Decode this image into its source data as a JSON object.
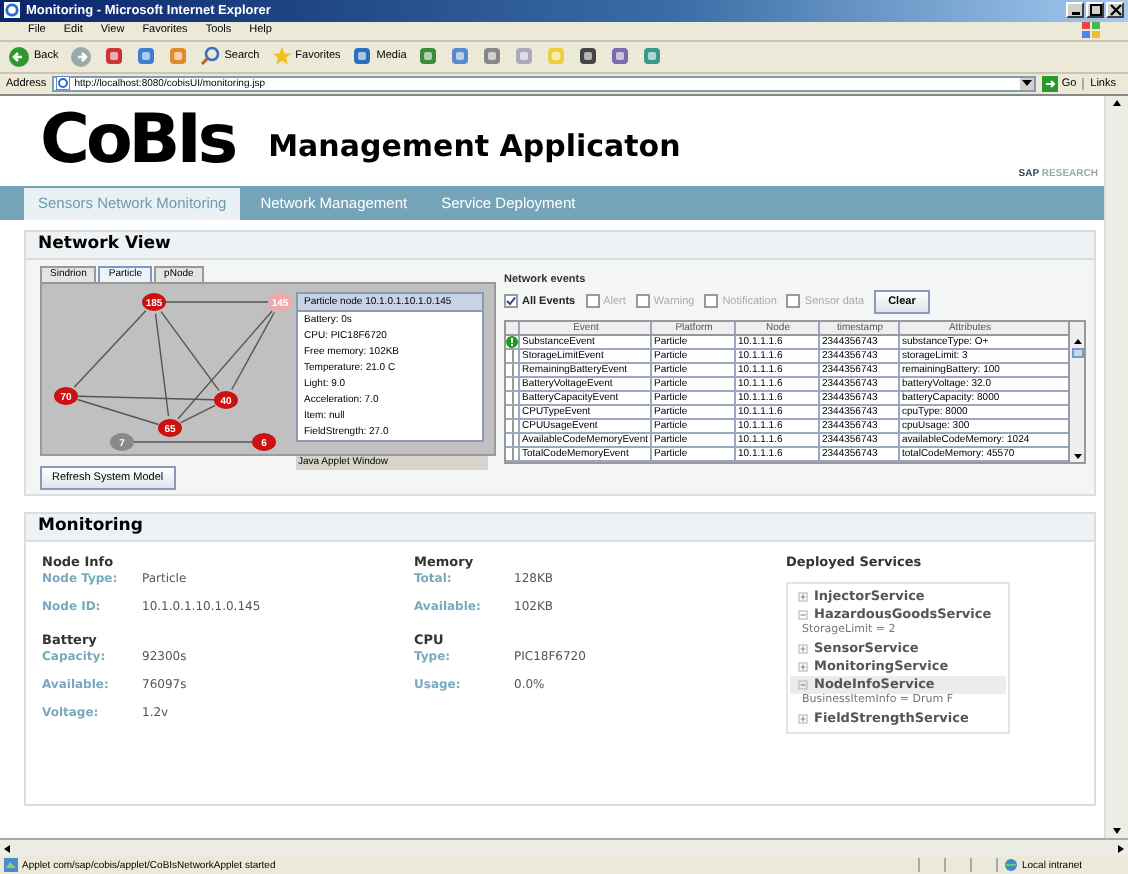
{
  "window": {
    "title": "Monitoring - Microsoft Internet Explorer"
  },
  "menu": [
    "File",
    "Edit",
    "View",
    "Favorites",
    "Tools",
    "Help"
  ],
  "toolbar": [
    {
      "kind": "back",
      "label": "Back"
    },
    {
      "kind": "forward"
    },
    {
      "kind": "stop"
    },
    {
      "kind": "refresh"
    },
    {
      "kind": "home"
    },
    {
      "kind": "search",
      "label": "Search"
    },
    {
      "kind": "favorites",
      "label": "Favorites"
    },
    {
      "kind": "media",
      "label": "Media"
    },
    {
      "kind": "history"
    },
    {
      "kind": "mail"
    },
    {
      "kind": "print"
    },
    {
      "kind": "edit"
    },
    {
      "kind": "note"
    },
    {
      "kind": "messenger"
    },
    {
      "kind": "tool"
    },
    {
      "kind": "network"
    }
  ],
  "address": {
    "label": "Address",
    "value": "http://localhost:8080/cobisUI/monitoring.jsp",
    "go": "Go",
    "links": "Links"
  },
  "header": {
    "logo": "CoBIs",
    "title": "Management Applicaton",
    "brand": "SAP",
    "brand_suffix": "RESEARCH"
  },
  "nav": [
    {
      "label": "Sensors Network Monitoring",
      "selected": true
    },
    {
      "label": "Network Management",
      "selected": false
    },
    {
      "label": "Service Deployment",
      "selected": false
    }
  ],
  "network_view": {
    "title": "Network View",
    "tabs": [
      {
        "label": "Sindrion",
        "selected": false
      },
      {
        "label": "Particle",
        "selected": true
      },
      {
        "label": "pNode",
        "selected": false
      }
    ],
    "nodes": [
      {
        "label": "185",
        "color": "#cc1111"
      },
      {
        "label": "145",
        "color": "#f2a8a8"
      },
      {
        "label": "70",
        "color": "#cc1111"
      },
      {
        "label": "40",
        "color": "#cc1111"
      },
      {
        "label": "65",
        "color": "#cc1111"
      },
      {
        "label": "7",
        "color": "#8a8a8a"
      },
      {
        "label": "6",
        "color": "#cc1111"
      }
    ],
    "tooltip": {
      "title": "Particle node 10.1.0.1.10.1.0.145",
      "lines": [
        "Battery: 0s",
        "CPU: PIC18F6720",
        "Free memory: 102KB",
        "Temperature: 21.0 C",
        "Light: 9.0",
        "Acceleration: 7.0",
        "Item: null",
        "FieldStrength: 27.0"
      ],
      "footer": "Java Applet Window"
    },
    "refresh_button": "Refresh System Model",
    "events": {
      "title": "Network events",
      "filters": [
        {
          "label": "All Events",
          "checked": true
        },
        {
          "label": "Alert",
          "checked": false
        },
        {
          "label": "Warning",
          "checked": false
        },
        {
          "label": "Notification",
          "checked": false
        },
        {
          "label": "Sensor data",
          "checked": false
        }
      ],
      "clear_button": "Clear",
      "columns": [
        "Event",
        "Platform",
        "Node",
        "timestamp",
        "Attributes"
      ],
      "rows": [
        {
          "kind": "alert",
          "cells": [
            "SubstanceEvent",
            "Particle",
            "10.1.1.1.6",
            "2344356743",
            "substanceType: O+"
          ]
        },
        {
          "kind": "plain",
          "cells": [
            "StorageLimitEvent",
            "Particle",
            "10.1.1.1.6",
            "2344356743",
            "storageLimit: 3"
          ]
        },
        {
          "kind": "plain",
          "cells": [
            "RemainingBatteryEvent",
            "Particle",
            "10.1.1.1.6",
            "2344356743",
            "remainingBattery: 100"
          ]
        },
        {
          "kind": "plain",
          "cells": [
            "BatteryVoltageEvent",
            "Particle",
            "10.1.1.1.6",
            "2344356743",
            "batteryVoltage: 32.0"
          ]
        },
        {
          "kind": "plain",
          "cells": [
            "BatteryCapacityEvent",
            "Particle",
            "10.1.1.1.6",
            "2344356743",
            "batteryCapacity: 8000"
          ]
        },
        {
          "kind": "plain",
          "cells": [
            "CPUTypeEvent",
            "Particle",
            "10.1.1.1.6",
            "2344356743",
            "cpuType: 8000"
          ]
        },
        {
          "kind": "plain",
          "cells": [
            "CPUUsageEvent",
            "Particle",
            "10.1.1.1.6",
            "2344356743",
            "cpuUsage: 300"
          ]
        },
        {
          "kind": "plain",
          "cells": [
            "AvailableCodeMemoryEvent",
            "Particle",
            "10.1.1.1.6",
            "2344356743",
            "availableCodeMemory: 1024"
          ]
        },
        {
          "kind": "plain",
          "cells": [
            "TotalCodeMemoryEvent",
            "Particle",
            "10.1.1.1.6",
            "2344356743",
            "totalCodeMemory: 45570"
          ]
        }
      ]
    }
  },
  "monitoring": {
    "title": "Monitoring",
    "columns": [
      {
        "sections": [
          {
            "title": "Node Info",
            "fields": [
              {
                "label": "Node Type:",
                "value": "Particle"
              },
              {
                "label": "Node ID:",
                "value": "10.1.0.1.10.1.0.145"
              }
            ]
          },
          {
            "title": "Battery",
            "fields": [
              {
                "label": "Capacity:",
                "value": "92300s"
              },
              {
                "label": "Available:",
                "value": "76097s"
              },
              {
                "label": "Voltage:",
                "value": "1.2v"
              }
            ]
          }
        ]
      },
      {
        "sections": [
          {
            "title": "Memory",
            "fields": [
              {
                "label": "Total:",
                "value": "128KB"
              },
              {
                "label": "Available:",
                "value": "102KB"
              }
            ]
          },
          {
            "title": "CPU",
            "fields": [
              {
                "label": "Type:",
                "value": "PIC18F6720"
              },
              {
                "label": "Usage:",
                "value": "0.0%"
              }
            ]
          }
        ]
      }
    ],
    "services": {
      "title": "Deployed Services",
      "items": [
        {
          "label": "InjectorService",
          "expanded": false,
          "selected": false
        },
        {
          "label": "HazardousGoodsService",
          "expanded": true,
          "selected": false,
          "children": [
            "StorageLimit = 2"
          ]
        },
        {
          "label": "SensorService",
          "expanded": false,
          "selected": false
        },
        {
          "label": "MonitoringService",
          "expanded": false,
          "selected": false
        },
        {
          "label": "NodeInfoService",
          "expanded": true,
          "selected": true,
          "children": [
            "BusinessItemInfo = Drum F"
          ]
        },
        {
          "label": "FieldStrengthService",
          "expanded": false,
          "selected": false
        }
      ]
    }
  },
  "status_bar": {
    "text": "Applet com/sap/cobis/applet/CoBIsNetworkApplet started",
    "zone": "Local intranet"
  }
}
